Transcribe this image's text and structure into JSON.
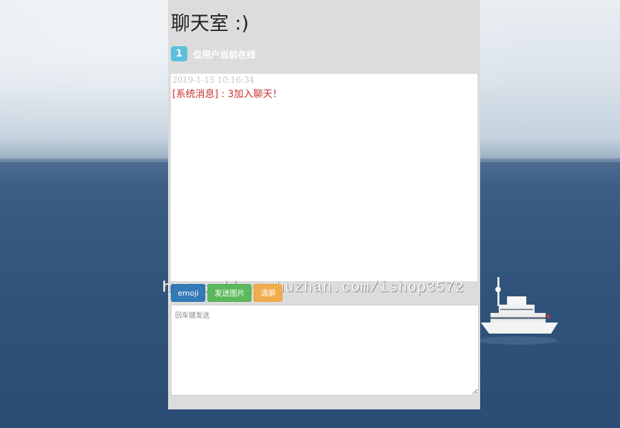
{
  "room": {
    "title": "聊天室 :)",
    "online_count": "1",
    "online_text": "位用户当前在线"
  },
  "messages": [
    {
      "time": "2019-1-15 10:16:34",
      "text": "[系统消息] : 3加入聊天！"
    }
  ],
  "toolbar": {
    "emoji_label": "emoji",
    "send_image_label": "发送图片",
    "clear_label": "清屏"
  },
  "input": {
    "placeholder": "回车键发送",
    "value": ""
  },
  "watermark": "https://www.huzhan.com/ishop3572",
  "colors": {
    "badge": "#5bc0de",
    "system_message": "#c9302c",
    "emoji_button": "#337ab7",
    "send_image_button": "#5cb85c",
    "clear_button": "#f0ad4e"
  }
}
